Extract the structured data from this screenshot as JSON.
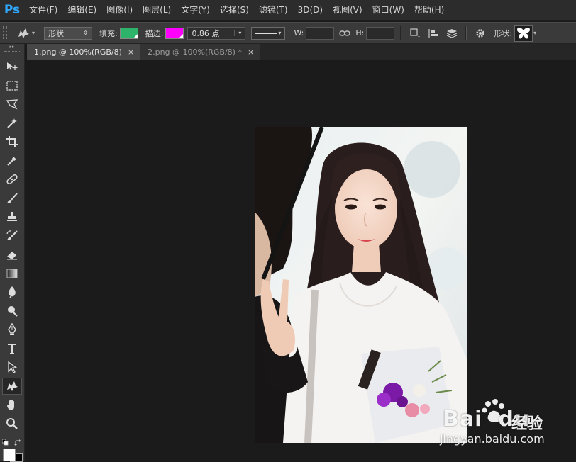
{
  "app": {
    "logo": "Ps"
  },
  "menu": [
    "文件(F)",
    "编辑(E)",
    "图像(I)",
    "图层(L)",
    "文字(Y)",
    "选择(S)",
    "滤镜(T)",
    "3D(D)",
    "视图(V)",
    "窗口(W)",
    "帮助(H)"
  ],
  "options": {
    "mode_value": "形状",
    "fill_label": "填充:",
    "fill_color": "#2eb36a",
    "stroke_label": "描边:",
    "stroke_color": "#ff00ff",
    "stroke_width": "0.86 点",
    "w_label": "W:",
    "h_label": "H:",
    "shape_label": "形状:",
    "shape_icon": "butterfly-icon"
  },
  "tabs": [
    {
      "label": "1.png @ 100%(RGB/8)",
      "close": "×",
      "active": true
    },
    {
      "label": "2.png @ 100%(RGB/8) *",
      "close": "×",
      "active": false
    }
  ],
  "tools": [
    "move-tool-icon",
    "marquee-tool-icon",
    "lasso-tool-icon",
    "magic-wand-icon",
    "crop-tool-icon",
    "eyedropper-icon",
    "healing-brush-icon",
    "brush-icon",
    "clone-stamp-icon",
    "history-brush-icon",
    "eraser-icon",
    "gradient-icon",
    "blur-icon",
    "dodge-icon",
    "pen-icon",
    "type-icon",
    "path-selection-icon",
    "custom-shape-icon",
    "hand-icon",
    "zoom-icon"
  ],
  "watermark": {
    "brand_a": "Bai",
    "brand_b": "du",
    "brand_c": "经验",
    "url": "jingyan.baidu.com"
  },
  "colors": {
    "foreground": "#ffffff",
    "background": "#000000"
  }
}
